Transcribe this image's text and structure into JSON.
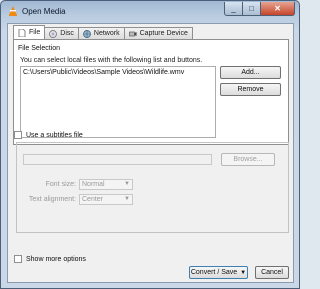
{
  "window": {
    "title": "Open Media"
  },
  "tabs": [
    {
      "label": "File",
      "icon": "file-icon"
    },
    {
      "label": "Disc",
      "icon": "disc-icon"
    },
    {
      "label": "Network",
      "icon": "network-icon"
    },
    {
      "label": "Capture Device",
      "icon": "capture-device-icon"
    }
  ],
  "file_selection": {
    "group_title": "File Selection",
    "hint": "You can select local files with the following list and buttons.",
    "files": [
      "C:\\Users\\Public\\Videos\\Sample Videos\\Wildlife.wmv"
    ],
    "add_label": "Add...",
    "remove_label": "Remove"
  },
  "subtitles": {
    "checkbox_label": "Use a subtitles file",
    "checked": false,
    "browse_label": "Browse...",
    "font_size_label": "Font size:",
    "font_size_value": "Normal",
    "alignment_label": "Text alignment:",
    "alignment_value": "Center"
  },
  "footer": {
    "show_more_label": "Show more options",
    "convert_label": "Convert / Save",
    "cancel_label": "Cancel"
  },
  "colors": {
    "title_bar": "#b9cbe0",
    "close_button": "#c5432a",
    "accent_border": "#3c7fb1"
  }
}
